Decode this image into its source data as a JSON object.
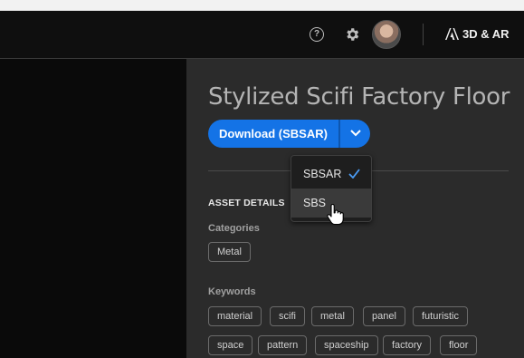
{
  "header": {
    "help_icon_glyph": "?",
    "brand": "3D & AR"
  },
  "asset": {
    "title": "Stylized Scifi Factory Floor",
    "download_label": "Download (SBSAR)",
    "details_heading": "ASSET DETAILS",
    "categories_label": "Categories",
    "categories": [
      "Metal"
    ],
    "keywords_label": "Keywords",
    "keywords": [
      "material",
      "scifi",
      "metal",
      "panel",
      "futuristic",
      "space",
      "pattern",
      "spaceship",
      "factory",
      "floor"
    ]
  },
  "download_menu": {
    "options": [
      {
        "label": "SBSAR",
        "selected": true
      },
      {
        "label": "SBS",
        "selected": false,
        "hovered": true
      }
    ]
  },
  "colors": {
    "accent": "#1473e6",
    "topbar": "#0f0f0f",
    "panel": "#2b2b2b"
  }
}
